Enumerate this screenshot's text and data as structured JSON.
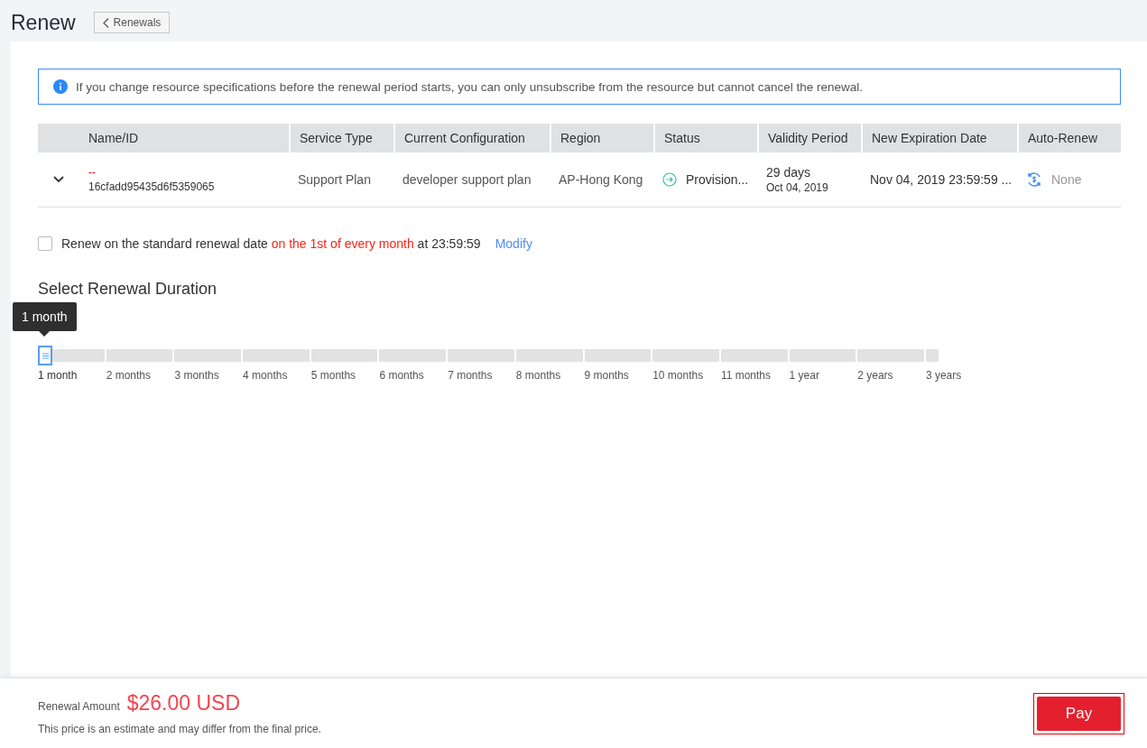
{
  "header": {
    "title": "Renew",
    "back_button": "Renewals"
  },
  "notice": {
    "text": "If you change resource specifications before the renewal period starts, you can only unsubscribe from the resource but cannot cancel the renewal."
  },
  "table": {
    "columns": [
      "Name/ID",
      "Service Type",
      "Current Configuration",
      "Region",
      "Status",
      "Validity Period",
      "New Expiration Date",
      "Auto-Renew"
    ],
    "rows": [
      {
        "expanded": false,
        "name": "--",
        "id": "16cfadd95435d6f5359065",
        "service_type": "Support Plan",
        "configuration": "developer support plan",
        "region": "AP-Hong Kong",
        "status": "Provision...",
        "validity": "29 days",
        "validity_date": "Oct 04, 2019",
        "expiration": "Nov 04, 2019 23:59:59 ...",
        "auto_renew": "None"
      }
    ]
  },
  "standard_renewal": {
    "checked": false,
    "segments": [
      {
        "text": "Renew on the standard renewal date ",
        "highlight": false
      },
      {
        "text": "on the 1st of every month",
        "highlight": true
      },
      {
        "text": " at 23:59:59",
        "highlight": false
      }
    ],
    "link": "Modify"
  },
  "duration": {
    "title": "Select Renewal Duration",
    "tooltip": "1 month",
    "steps": [
      {
        "label": "1 month",
        "selected": true
      },
      {
        "label": "2 months",
        "selected": false
      },
      {
        "label": "3 months",
        "selected": false
      },
      {
        "label": "4 months",
        "selected": false
      },
      {
        "label": "5 months",
        "selected": false
      },
      {
        "label": "6 months",
        "selected": false
      },
      {
        "label": "7 months",
        "selected": false
      },
      {
        "label": "8 months",
        "selected": false
      },
      {
        "label": "9 months",
        "selected": false
      },
      {
        "label": "10 months",
        "selected": false
      },
      {
        "label": "11 months",
        "selected": false
      },
      {
        "label": "1 year",
        "selected": false
      },
      {
        "label": "2 years",
        "selected": false
      },
      {
        "label": "3 years",
        "selected": false
      }
    ]
  },
  "footer": {
    "amount_label": "Renewal Amount",
    "amount": "$26.00 USD",
    "note": "This price is an estimate and may differ from the final price.",
    "pay_button": "Pay"
  }
}
